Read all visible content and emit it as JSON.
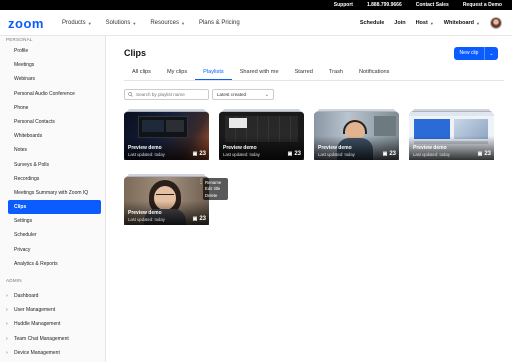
{
  "topbar": {
    "support": "Support",
    "phone": "1.888.799.9666",
    "contact_sales": "Contact Sales",
    "request_demo": "Request a Demo"
  },
  "nav": {
    "logo": "zoom",
    "main": [
      {
        "label": "Products",
        "has_caret": true
      },
      {
        "label": "Solutions",
        "has_caret": true
      },
      {
        "label": "Resources",
        "has_caret": true
      },
      {
        "label": "Plans & Pricing",
        "has_caret": false
      }
    ],
    "right": [
      {
        "label": "Schedule"
      },
      {
        "label": "Join"
      },
      {
        "label": "Host",
        "has_caret": true
      },
      {
        "label": "Whiteboard",
        "has_caret": true
      }
    ]
  },
  "sidebar": {
    "personal_heading": "PERSONAL",
    "personal_items": [
      "Profile",
      "Meetings",
      "Webinars",
      "Personal Audio Conference",
      "Phone",
      "Personal Contacts",
      "Whiteboards",
      "Notes",
      "Surveys & Polls",
      "Recordings",
      "Meetings Summary with Zoom IQ",
      "Clips",
      "Settings",
      "Scheduler",
      "Privacy",
      "Analytics & Reports"
    ],
    "active_item": "Clips",
    "admin_heading": "ADMIN",
    "admin_items": [
      "Dashboard",
      "User Management",
      "Huddle Management",
      "Team Chat Management",
      "Device Management"
    ]
  },
  "main": {
    "title": "Clips",
    "new_clip": "New clip",
    "tabs": [
      "All clips",
      "My clips",
      "Playlists",
      "Shared with me",
      "Starred",
      "Trash",
      "Notifications"
    ],
    "active_tab": "Playlists",
    "search_placeholder": "Search by playlist name",
    "sort_value": "Latest created",
    "cards": [
      {
        "title": "Preview demo",
        "updated": "Last updated: today",
        "count": "23"
      },
      {
        "title": "Preview demo",
        "updated": "Last updated: today",
        "count": "23"
      },
      {
        "title": "Preview demo",
        "updated": "Last updated: today",
        "count": "23"
      },
      {
        "title": "Preview demo",
        "updated": "Last updated: today",
        "count": "23"
      },
      {
        "title": "Preview demo",
        "updated": "Last updated: today",
        "count": "23"
      }
    ],
    "card_menu": [
      "Rename",
      "Edit title",
      "Delete"
    ]
  },
  "colors": {
    "accent": "#0b5cff",
    "topbar_bg": "#000000"
  }
}
